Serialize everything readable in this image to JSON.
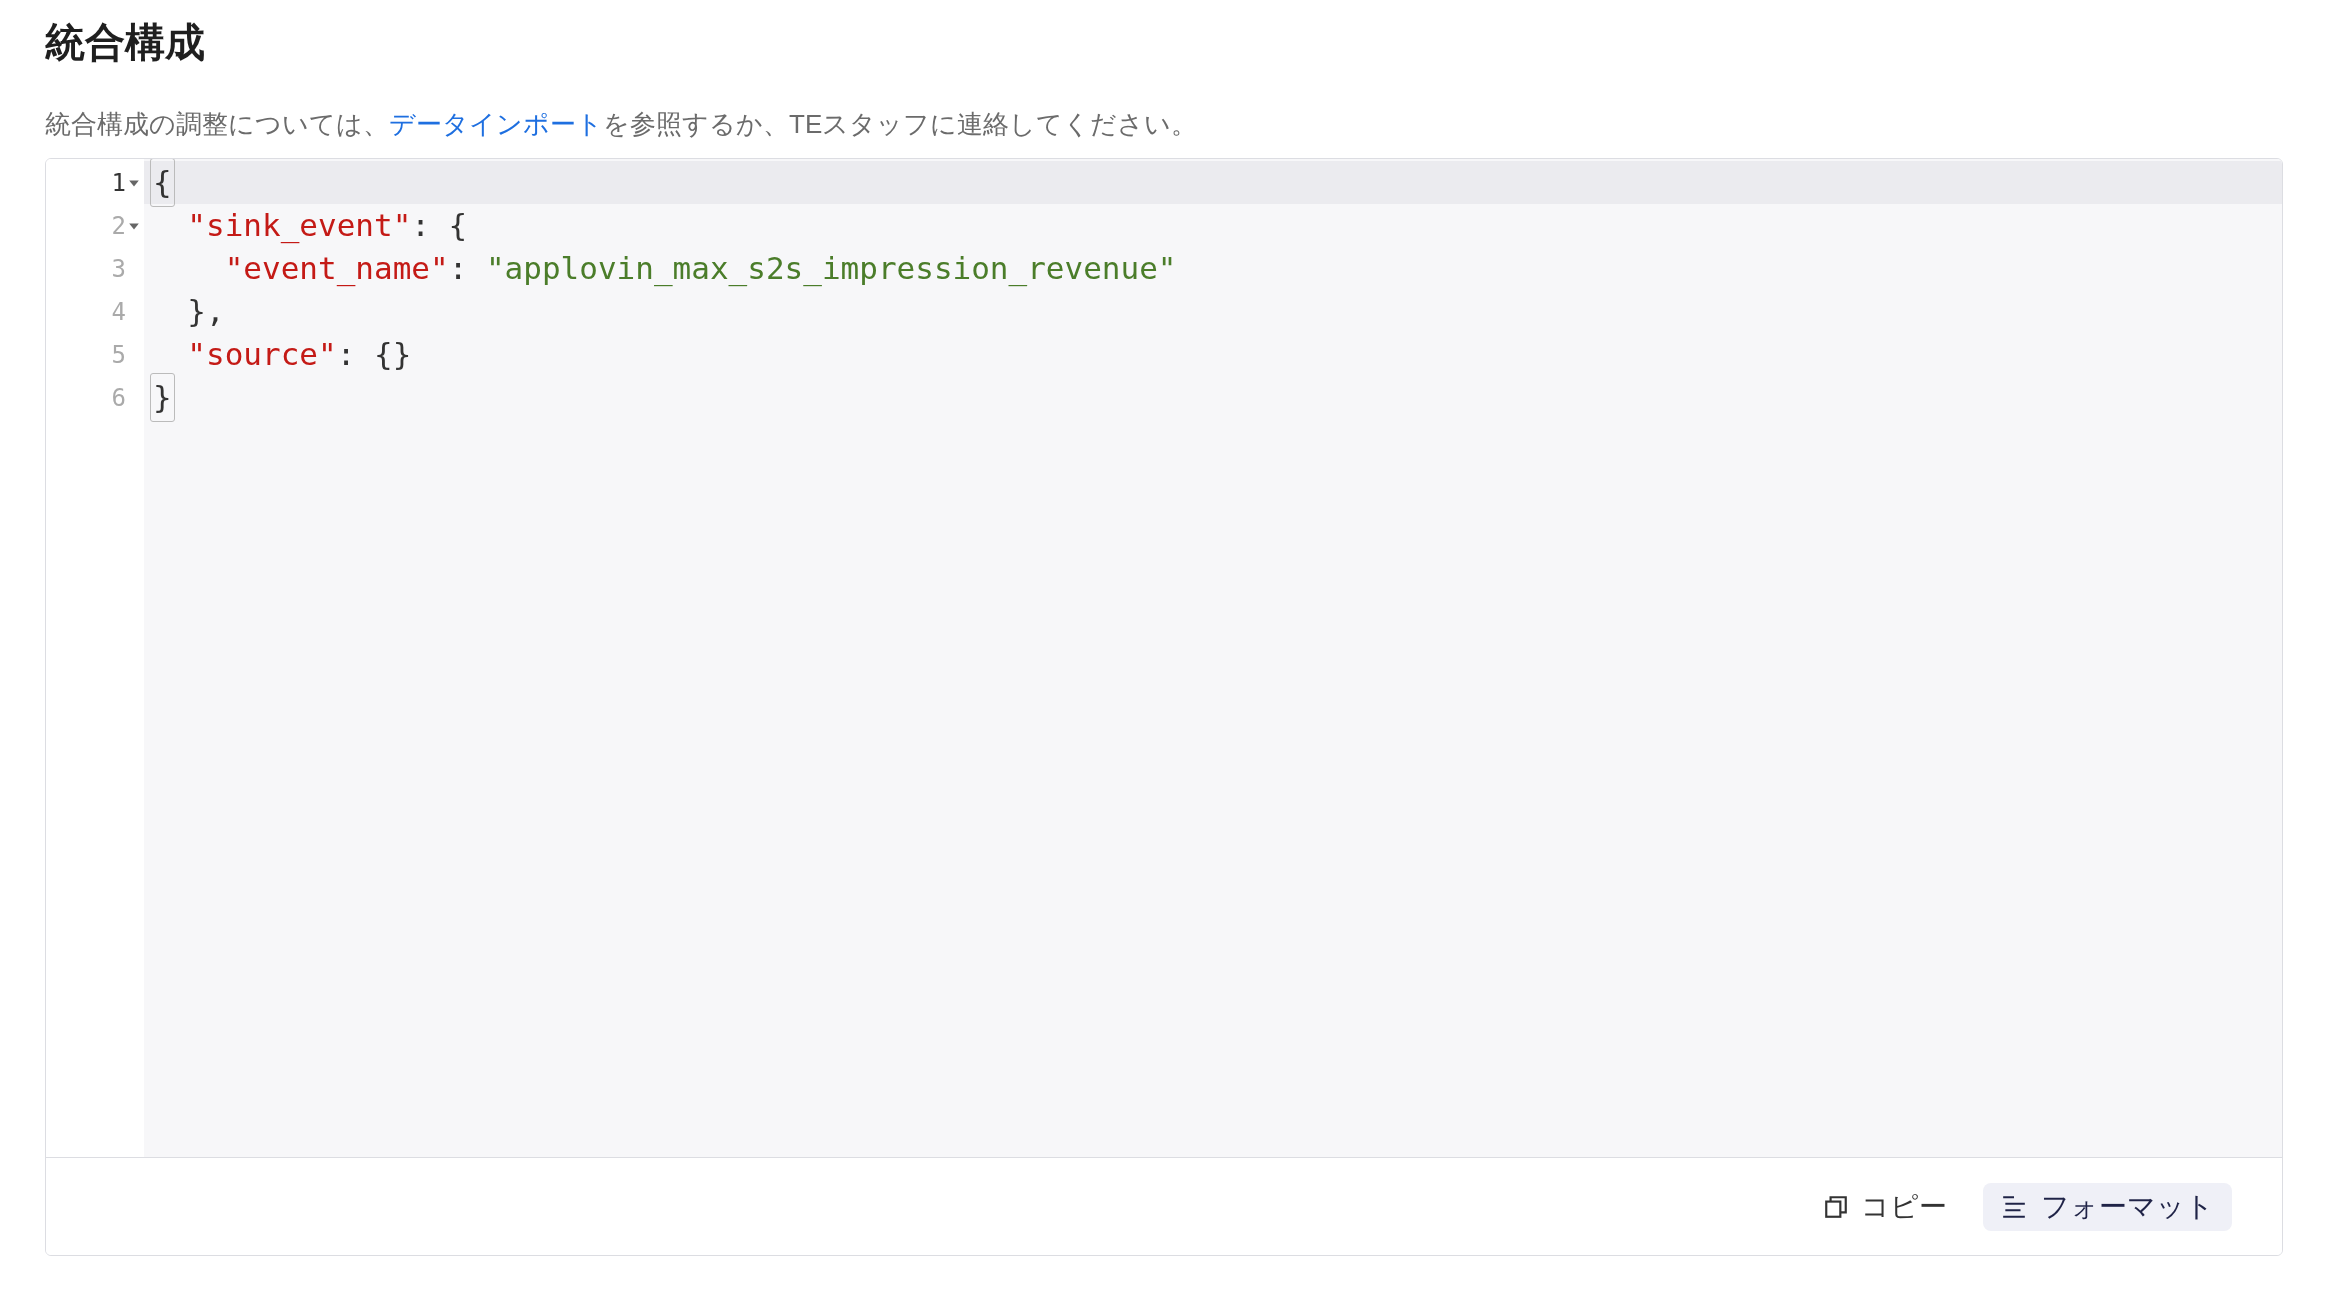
{
  "title": "統合構成",
  "description": {
    "before": "統合構成の調整については、",
    "link": "データインポート",
    "after": "を参照するか、TEスタッフに連絡してください。"
  },
  "editor": {
    "lines": [
      {
        "number": "1",
        "foldable": true,
        "active": true,
        "tokens": [
          {
            "kind": "punct",
            "text": "{",
            "matched": true
          }
        ]
      },
      {
        "number": "2",
        "foldable": true,
        "active": false,
        "tokens": [
          {
            "kind": "key",
            "text": "  \"sink_event\"",
            "matched": false
          },
          {
            "kind": "punct",
            "text": ": {",
            "matched": false
          }
        ]
      },
      {
        "number": "3",
        "foldable": false,
        "active": false,
        "tokens": [
          {
            "kind": "key",
            "text": "    \"event_name\"",
            "matched": false
          },
          {
            "kind": "punct",
            "text": ": ",
            "matched": false
          },
          {
            "kind": "string",
            "text": "\"applovin_max_s2s_impression_revenue\"",
            "matched": false
          }
        ]
      },
      {
        "number": "4",
        "foldable": false,
        "active": false,
        "tokens": [
          {
            "kind": "punct",
            "text": "  },",
            "matched": false
          }
        ]
      },
      {
        "number": "5",
        "foldable": false,
        "active": false,
        "tokens": [
          {
            "kind": "key",
            "text": "  \"source\"",
            "matched": false
          },
          {
            "kind": "punct",
            "text": ": {}",
            "matched": false
          }
        ]
      },
      {
        "number": "6",
        "foldable": false,
        "active": false,
        "tokens": [
          {
            "kind": "punct",
            "text": "}",
            "matched": true
          }
        ]
      }
    ]
  },
  "buttons": [
    {
      "kind": "copy",
      "label": "コピー"
    },
    {
      "kind": "format",
      "label": "フォーマット"
    }
  ]
}
